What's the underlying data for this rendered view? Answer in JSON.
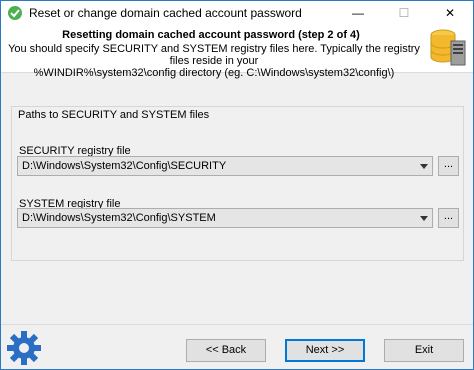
{
  "window": {
    "title": "Reset or change domain cached account password",
    "minimize_glyph": "—",
    "maximize_glyph": "☐",
    "close_glyph": "✕"
  },
  "header": {
    "step_title": "Resetting domain cached account password (step 2 of 4)",
    "description_line1": "You should specify SECURITY and SYSTEM registry files here. Typically the registry files reside in your",
    "description_line2": "%WINDIR%\\system32\\config directory (eg. C:\\Windows\\system32\\config\\)",
    "icon": "database-server-icon"
  },
  "group": {
    "label": "Paths to SECURITY and SYSTEM files",
    "security": {
      "label": "SECURITY registry file",
      "value": "D:\\Windows\\System32\\Config\\SECURITY",
      "browse_label": "..."
    },
    "system": {
      "label": "SYSTEM registry file",
      "value": "D:\\Windows\\System32\\Config\\SYSTEM",
      "browse_label": "..."
    }
  },
  "footer": {
    "back_label": "<< Back",
    "next_label": "Next >>",
    "exit_label": "Exit",
    "icon": "gear-icon"
  },
  "colors": {
    "accent": "#0078d7",
    "window_border": "#2b79c4",
    "background": "#f0f0f0"
  }
}
